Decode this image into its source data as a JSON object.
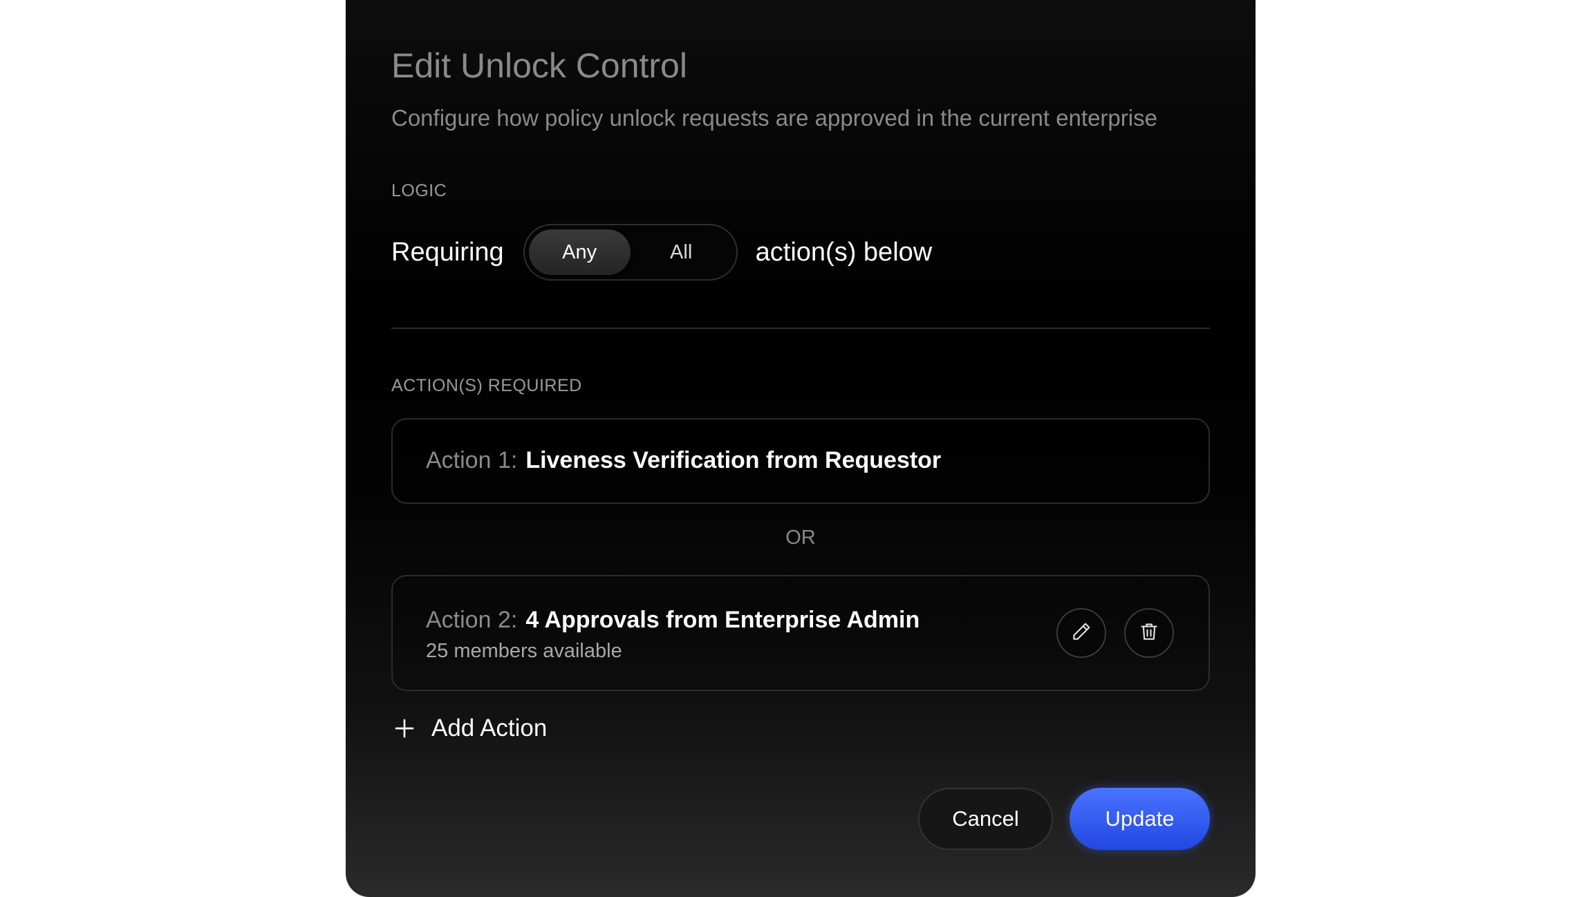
{
  "dialog": {
    "title": "Edit Unlock Control",
    "subtitle": "Configure how policy unlock requests are approved in the current enterprise"
  },
  "logic": {
    "section_label": "LOGIC",
    "prefix": "Requiring",
    "options": [
      "Any",
      "All"
    ],
    "selected": "Any",
    "suffix": "action(s) below"
  },
  "actions": {
    "section_label": "ACTION(S) REQUIRED",
    "separator": "OR",
    "items": [
      {
        "prefix": "Action 1:",
        "name": "Liveness Verification from Requestor"
      },
      {
        "prefix": "Action 2:",
        "name": "4 Approvals from Enterprise Admin",
        "detail": "25 members available",
        "icons": [
          "pencil-icon",
          "trash-icon"
        ]
      }
    ],
    "add_label": "Add Action"
  },
  "footer": {
    "cancel_label": "Cancel",
    "update_label": "Update"
  },
  "colors": {
    "primary": "#2f5bf5",
    "dialog_background": "#000000",
    "muted_text": "#8a8a8a"
  }
}
